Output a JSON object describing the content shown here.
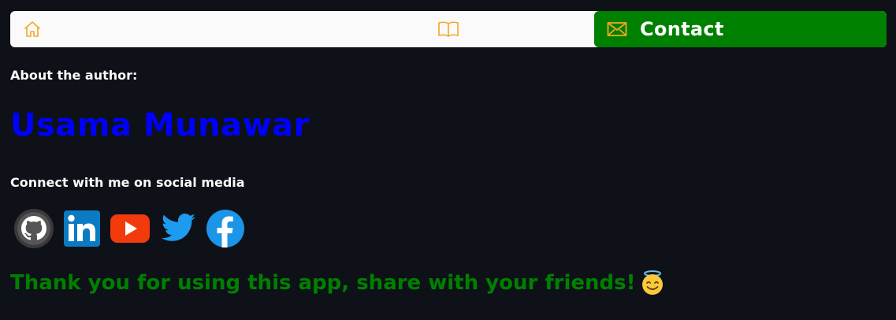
{
  "nav": {
    "items": [
      {
        "icon": "home-icon",
        "label": ""
      },
      {
        "icon": "book-icon",
        "label": ""
      },
      {
        "icon": "envelope-icon",
        "label": "Contact"
      }
    ],
    "active_index": 2,
    "accent_color": "#008000",
    "icon_color": "#f5a623"
  },
  "main": {
    "about_label": "About the author:",
    "author_name": "Usama Munawar",
    "author_color": "#0000ff",
    "connect_label": "Connect with me on social media",
    "social_icons": [
      "github-icon",
      "linkedin-icon",
      "youtube-icon",
      "twitter-icon",
      "facebook-icon"
    ],
    "thanks_text": "Thank you for using this app, share with your friends!",
    "thanks_emoji": "smiling-face-with-halo-icon",
    "thanks_color": "#008000"
  }
}
